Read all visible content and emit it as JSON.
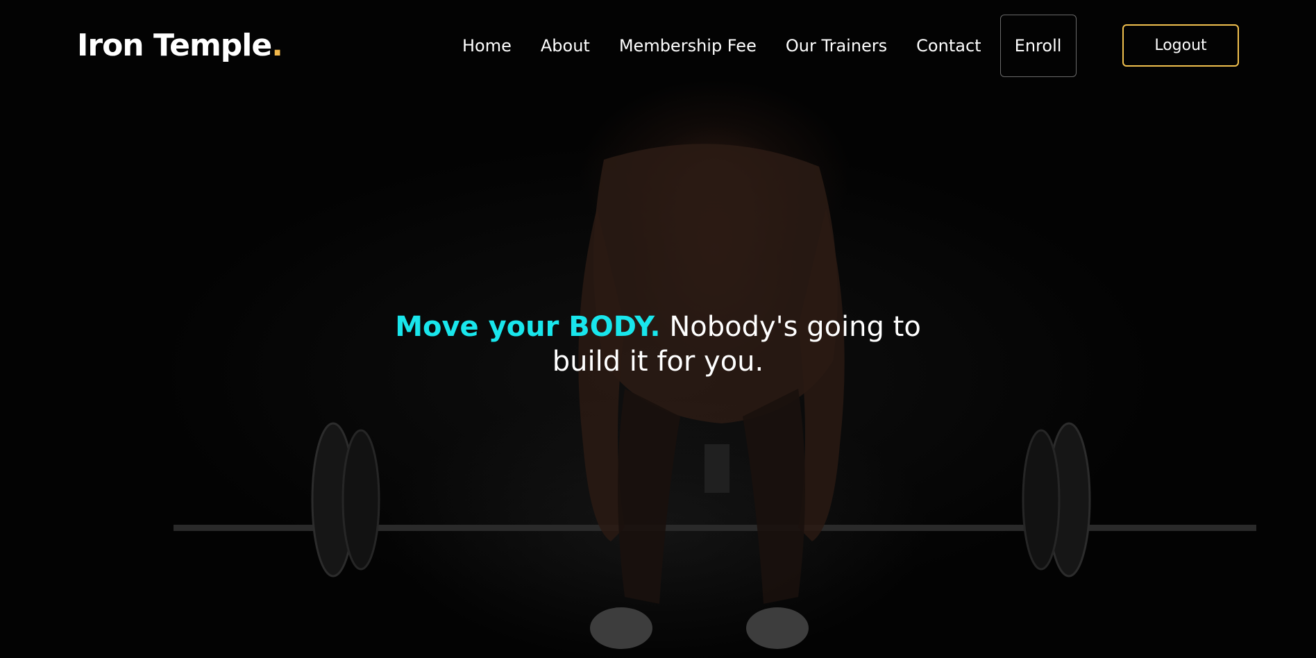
{
  "brand": {
    "name": "Iron Temple",
    "dot": "."
  },
  "nav": {
    "items": [
      {
        "label": "Home"
      },
      {
        "label": "About"
      },
      {
        "label": "Membership Fee"
      },
      {
        "label": "Our Trainers"
      },
      {
        "label": "Contact"
      }
    ],
    "enroll_label": "Enroll",
    "logout_label": "Logout"
  },
  "hero": {
    "headline_accent": "Move your BODY.",
    "headline_rest_line1": " Nobody's going to",
    "headline_line2": "build it for you."
  },
  "colors": {
    "accent_cyan": "#19e6ec",
    "accent_gold": "#f2c14e",
    "background": "#030303",
    "text": "#ffffff"
  }
}
